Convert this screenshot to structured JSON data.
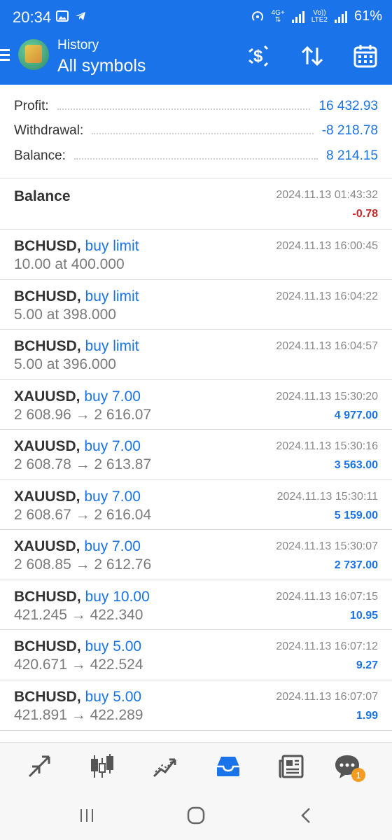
{
  "status": {
    "time": "20:34",
    "net1_top": "4G+",
    "net2_top": "Vo))",
    "net2_bottom": "LTE2",
    "battery": "61%"
  },
  "header": {
    "subtitle": "History",
    "title": "All symbols",
    "accent": "#1a73e8"
  },
  "summary": {
    "profit_label": "Profit:",
    "profit_value": "16 432.93",
    "withdrawal_label": "Withdrawal:",
    "withdrawal_value": "-8 218.78",
    "balance_label": "Balance:",
    "balance_value": "8 214.15"
  },
  "balance_entry": {
    "label": "Balance",
    "time": "2024.11.13 01:43:32",
    "amount": "-0.78"
  },
  "orders": [
    {
      "symbol": "BCHUSD,",
      "action": "buy limit",
      "detail": "10.00 at 400.000",
      "time": "2024.11.13 16:00:45",
      "profit": ""
    },
    {
      "symbol": "BCHUSD,",
      "action": "buy limit",
      "detail": "5.00 at 398.000",
      "time": "2024.11.13 16:04:22",
      "profit": ""
    },
    {
      "symbol": "BCHUSD,",
      "action": "buy limit",
      "detail": "5.00 at 396.000",
      "time": "2024.11.13 16:04:57",
      "profit": ""
    },
    {
      "symbol": "XAUUSD,",
      "action": "buy 7.00",
      "detail": "2 608.96 → 2 616.07",
      "time": "2024.11.13 15:30:20",
      "profit": "4 977.00"
    },
    {
      "symbol": "XAUUSD,",
      "action": "buy 7.00",
      "detail": "2 608.78 → 2 613.87",
      "time": "2024.11.13 15:30:16",
      "profit": "3 563.00"
    },
    {
      "symbol": "XAUUSD,",
      "action": "buy 7.00",
      "detail": "2 608.67 → 2 616.04",
      "time": "2024.11.13 15:30:11",
      "profit": "5 159.00"
    },
    {
      "symbol": "XAUUSD,",
      "action": "buy 7.00",
      "detail": "2 608.85 → 2 612.76",
      "time": "2024.11.13 15:30:07",
      "profit": "2 737.00"
    },
    {
      "symbol": "BCHUSD,",
      "action": "buy 10.00",
      "detail": "421.245 → 422.340",
      "time": "2024.11.13 16:07:15",
      "profit": "10.95"
    },
    {
      "symbol": "BCHUSD,",
      "action": "buy 5.00",
      "detail": "420.671 → 422.524",
      "time": "2024.11.13 16:07:12",
      "profit": "9.27"
    },
    {
      "symbol": "BCHUSD,",
      "action": "buy 5.00",
      "detail": "421.891 → 422.289",
      "time": "2024.11.13 16:07:07",
      "profit": "1.99"
    }
  ],
  "bottom_nav": {
    "items": [
      "quotes-icon",
      "chart-icon",
      "trade-icon",
      "history-icon",
      "news-icon",
      "chat-icon"
    ],
    "active": "history-icon",
    "chat_badge": "1"
  }
}
